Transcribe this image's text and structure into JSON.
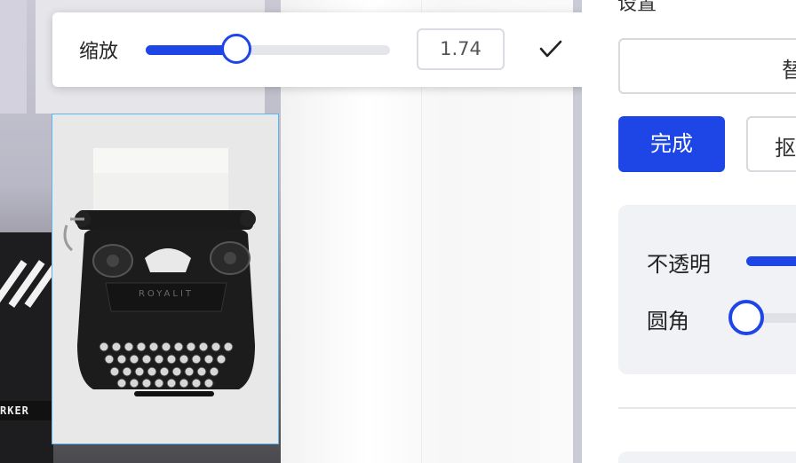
{
  "zoom": {
    "label": "缩放",
    "value": "1.74",
    "slider_fraction": 0.37
  },
  "panel": {
    "section_title": "设置",
    "input_text": "替",
    "done_label": "完成",
    "second_label": "抠",
    "opacity_label": "不透明",
    "opacity_fraction": 1.0,
    "radius_label": "圆角",
    "radius_fraction": 0.0
  },
  "background": {
    "sign_text": "RKER"
  },
  "image": {
    "brand_text": "ROYALIT"
  },
  "colors": {
    "accent": "#1e46e6",
    "selection": "#5db4f5"
  }
}
